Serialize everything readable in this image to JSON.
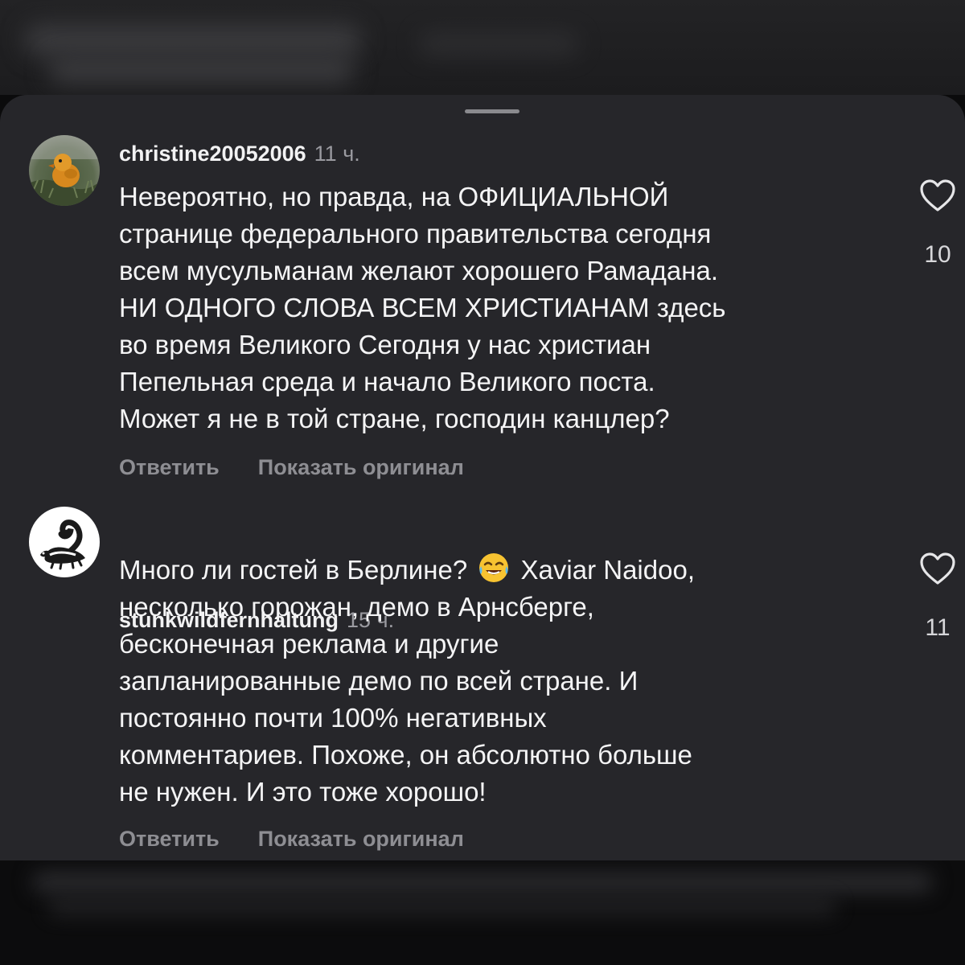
{
  "comments": [
    {
      "username": "christine20052006",
      "time": "11 ч.",
      "lines": [
        "Невероятно, но правда, на ОФИЦИАЛЬНОЙ",
        "странице федерального правительства сегодня",
        "всем мусульманам желают хорошего Рамадана.",
        "НИ ОДНОГО СЛОВА ВСЕМ ХРИСТИАНАМ здесь",
        "во время Великого Сегодня у нас христиан",
        "Пепельная среда и начало Великого поста.",
        "Может я не в той стране, господин канцлер?"
      ],
      "reply_label": "Ответить",
      "show_original_label": "Показать оригинал",
      "likes": "10",
      "avatar_icon": "duck-photo-avatar"
    },
    {
      "username": "stunkwildfernhaltung",
      "time": "15 ч.",
      "line1_before_emoji": "Много ли гостей в Берлине?",
      "line1_emoji": "face-with-tears-of-joy",
      "line1_after_emoji": "Xaviar Naidoo,",
      "lines": [
        "несколько горожан, демо в Арнсберге,",
        "бесконечная реклама и другие",
        "запланированные демо по всей стране. И",
        "постоянно почти 100% негативных",
        "комментариев. Похоже, он абсолютно больше",
        "не нужен. И это тоже хорошо!"
      ],
      "reply_label": "Ответить",
      "show_original_label": "Показать оригинал",
      "likes": "11",
      "avatar_icon": "skunk-logo-avatar"
    }
  ],
  "colors": {
    "sheet_background": "#26262a",
    "outer_background": "#0b0b0c",
    "username": "#f2f2f3",
    "secondary_text": "#8e8e93",
    "body_text": "#f4f4f5"
  }
}
